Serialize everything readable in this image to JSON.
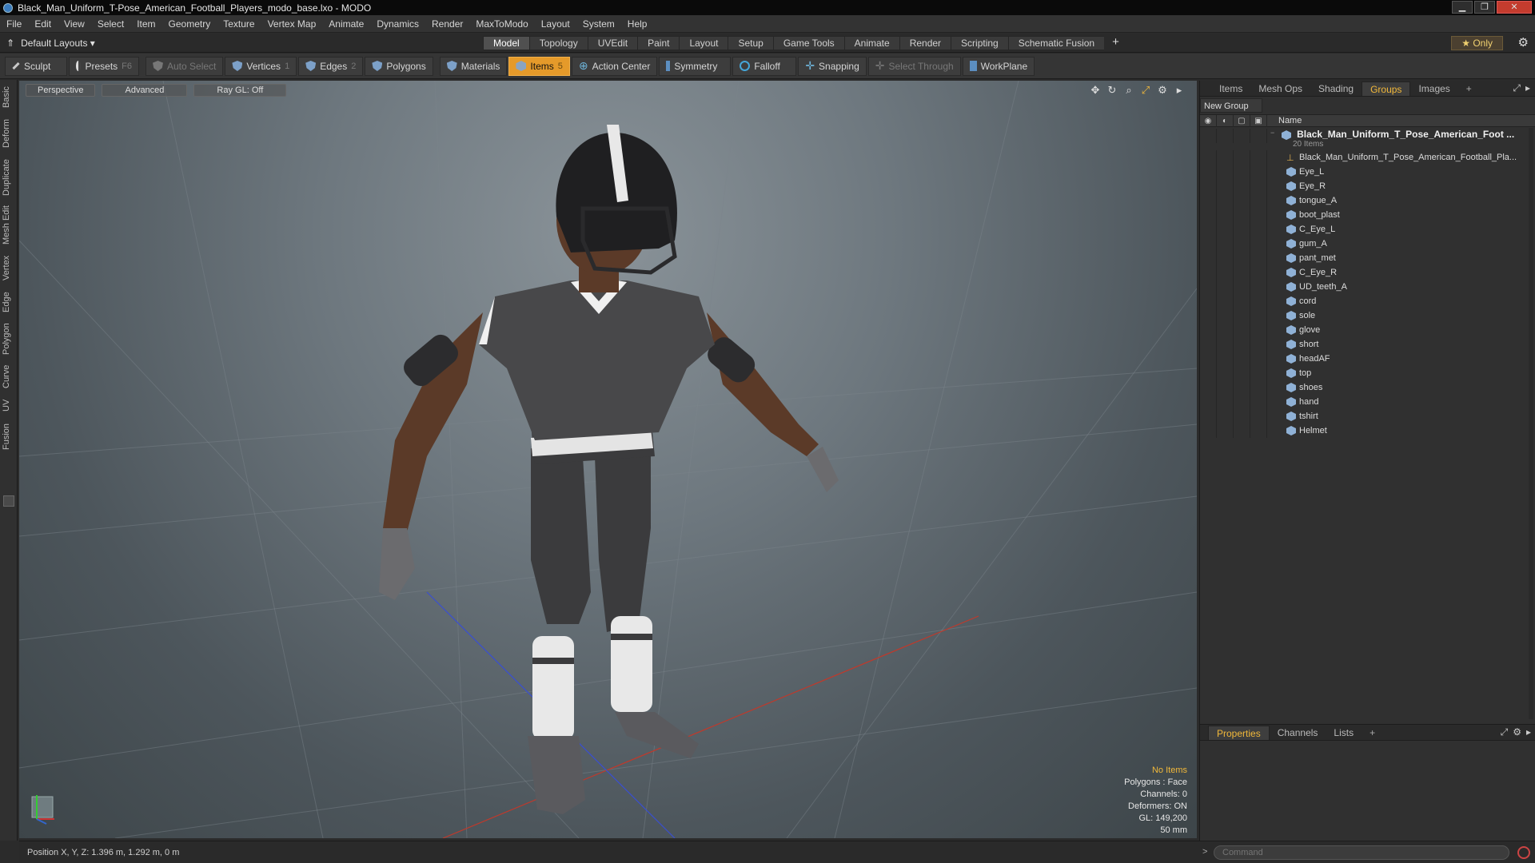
{
  "window": {
    "title": "Black_Man_Uniform_T-Pose_American_Football_Players_modo_base.lxo - MODO",
    "buttons": {
      "minimize": "▁",
      "maximize": "❐",
      "close": "✕"
    }
  },
  "menu": [
    "File",
    "Edit",
    "View",
    "Select",
    "Item",
    "Geometry",
    "Texture",
    "Vertex Map",
    "Animate",
    "Dynamics",
    "Render",
    "MaxToModo",
    "Layout",
    "System",
    "Help"
  ],
  "layouts": {
    "selector": "Default Layouts ▾",
    "tabs": [
      "Model",
      "Topology",
      "UVEdit",
      "Paint",
      "Layout",
      "Setup",
      "Game Tools",
      "Animate",
      "Render",
      "Scripting",
      "Schematic Fusion"
    ],
    "active_tab": "Model",
    "plus": "+",
    "only": "★ Only"
  },
  "toolbar": {
    "sculpt": "Sculpt",
    "presets": "Presets",
    "presets_key": "F6",
    "auto_select": "Auto Select",
    "vertices": "Vertices",
    "vertices_key": "1",
    "edges": "Edges",
    "edges_key": "2",
    "polygons": "Polygons",
    "materials": "Materials",
    "items": "Items",
    "items_key": "5",
    "action_center": "Action Center",
    "symmetry": "Symmetry",
    "falloff": "Falloff",
    "snapping": "Snapping",
    "select_through": "Select Through",
    "workplane": "WorkPlane"
  },
  "left_tabs": [
    "Basic",
    "Deform",
    "Duplicate",
    "Mesh Edit",
    "Vertex",
    "Edge",
    "Polygon",
    "Curve",
    "UV",
    "Fusion"
  ],
  "viewport": {
    "view": "Perspective",
    "shading": "Advanced",
    "raygl": "Ray GL: Off",
    "info": {
      "no_items": "No Items",
      "polygons": "Polygons : Face",
      "channels": "Channels: 0",
      "deformers": "Deformers: ON",
      "gl": "GL: 149,200",
      "lens": "50 mm"
    }
  },
  "right_panel": {
    "tabs": [
      "Items",
      "Mesh Ops",
      "Shading",
      "Groups",
      "Images"
    ],
    "active_tab": "Groups",
    "new_group": "New Group",
    "name_header": "Name",
    "root": {
      "label": "Black_Man_Uniform_T_Pose_American_Foot ...",
      "count": "20 Items"
    },
    "locator": "Black_Man_Uniform_T_Pose_American_Football_Pla...",
    "items": [
      "Eye_L",
      "Eye_R",
      "tongue_A",
      "boot_plast",
      "C_Eye_L",
      "gum_A",
      "pant_met",
      "C_Eye_R",
      "UD_teeth_A",
      "cord",
      "sole",
      "glove",
      "short",
      "headAF",
      "top",
      "shoes",
      "hand",
      "tshirt",
      "Helmet"
    ]
  },
  "bottom_panel": {
    "tabs": [
      "Properties",
      "Channels",
      "Lists"
    ],
    "active_tab": "Properties"
  },
  "command": {
    "placeholder": "Command",
    "prompt": ">"
  },
  "status": {
    "position": "Position X, Y, Z:  1.396 m, 1.292 m, 0 m"
  }
}
